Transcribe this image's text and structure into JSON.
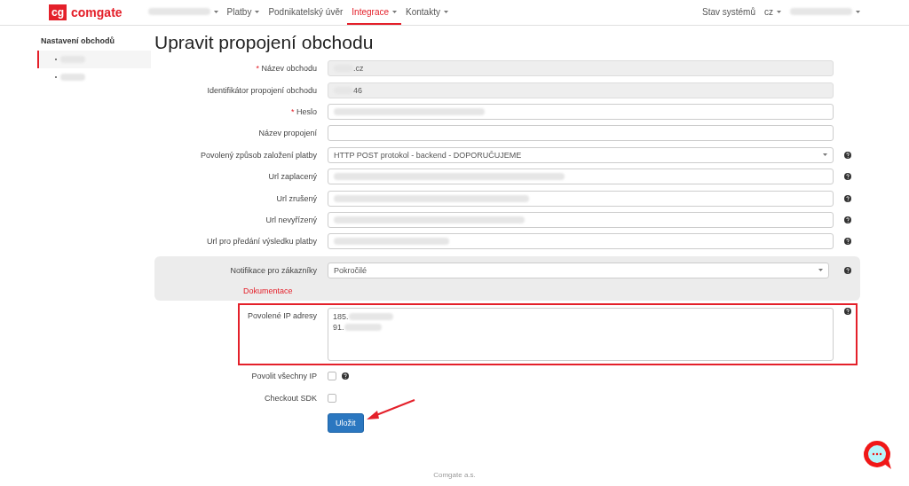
{
  "navbar": {
    "logo": {
      "mark": "cg",
      "name": "comgate"
    },
    "items": [
      {
        "kind": "redacted",
        "dropdown": true,
        "selected": false
      },
      {
        "kind": "text",
        "label": "Platby",
        "dropdown": true,
        "selected": false
      },
      {
        "kind": "text",
        "label": "Podnikatelský úvěr",
        "dropdown": false,
        "selected": false
      },
      {
        "kind": "text",
        "label": "Integrace",
        "dropdown": true,
        "selected": true
      },
      {
        "kind": "text",
        "label": "Kontakty",
        "dropdown": true,
        "selected": false
      }
    ],
    "right_items": [
      {
        "kind": "text",
        "label": "Stav systémů",
        "dropdown": false
      },
      {
        "kind": "text",
        "label": "cz",
        "dropdown": true
      },
      {
        "kind": "redacted",
        "dropdown": true
      }
    ]
  },
  "sidebar": {
    "title": "Nastavení obchodů",
    "items": [
      {
        "selected": true
      },
      {
        "selected": false
      }
    ]
  },
  "title": "Upravit propojení obchodu",
  "required_mark": "*",
  "fields": [
    {
      "kind": "text",
      "label": "Název obchodu",
      "required": true,
      "readonly": true,
      "value": ".cz",
      "redacted": true,
      "help": false
    },
    {
      "kind": "text",
      "label": "Identifikátor propojení obchodu",
      "required": false,
      "readonly": true,
      "value": "46",
      "redacted": true,
      "help": false
    },
    {
      "kind": "text",
      "label": "Heslo",
      "required": true,
      "readonly": false,
      "redacted": true,
      "help": false
    },
    {
      "kind": "text",
      "label": "Název propojení",
      "required": false,
      "readonly": false,
      "redacted": false,
      "help": false
    },
    {
      "kind": "select",
      "label": "Povolený způsob založení platby",
      "value": "HTTP POST protokol - backend - DOPORUČUJEME",
      "help": true
    },
    {
      "kind": "text",
      "label": "Url zaplacený",
      "required": false,
      "readonly": false,
      "redacted": true,
      "help": true
    },
    {
      "kind": "text",
      "label": "Url zrušený",
      "required": false,
      "readonly": false,
      "redacted": true,
      "help": true
    },
    {
      "kind": "text",
      "label": "Url nevyřízený",
      "required": false,
      "readonly": false,
      "redacted": true,
      "help": true
    },
    {
      "kind": "text",
      "label": "Url pro předání výsledku platby",
      "required": false,
      "readonly": false,
      "redacted": true,
      "help": true
    }
  ],
  "notification": {
    "label": "Notifikace pro zákazníky",
    "value": "Pokročilé",
    "help": true,
    "link": "Dokumentace"
  },
  "ip_field": {
    "label": "Povolené IP adresy",
    "lines": [
      "185.",
      "91."
    ],
    "highlighted": true,
    "help": true
  },
  "checkboxes": [
    {
      "label": "Povolit všechny IP",
      "checked": false,
      "help": true
    },
    {
      "label": "Checkout SDK",
      "checked": false,
      "help": false
    }
  ],
  "save_button": "Uložit",
  "footer": "Comgate a.s."
}
